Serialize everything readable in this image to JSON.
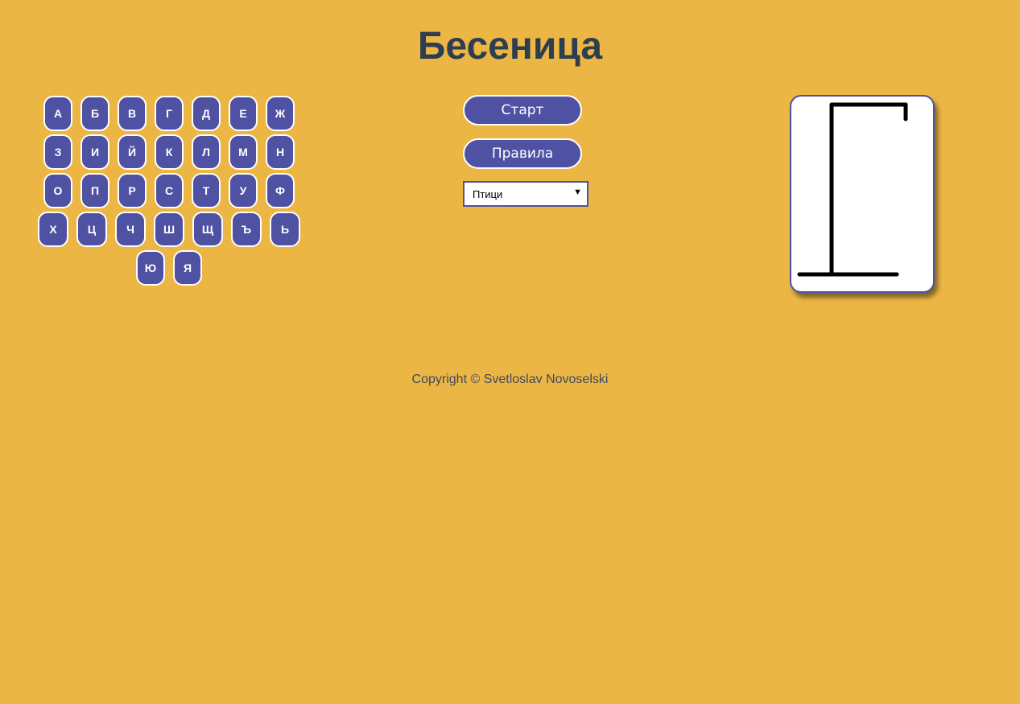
{
  "header": {
    "title": "Бесеница"
  },
  "keyboard": {
    "rows": [
      [
        "А",
        "Б",
        "В",
        "Г",
        "Д",
        "Е",
        "Ж"
      ],
      [
        "З",
        "И",
        "Й",
        "К",
        "Л",
        "М",
        "Н"
      ],
      [
        "О",
        "П",
        "Р",
        "С",
        "Т",
        "У",
        "Ф"
      ],
      [
        "Х",
        "Ц",
        "Ч",
        "Ш",
        "Щ",
        "Ъ",
        "Ь"
      ],
      [
        "Ю",
        "Я"
      ]
    ]
  },
  "controls": {
    "start_label": "Старт",
    "rules_label": "Правила",
    "category": {
      "selected": "Птици"
    }
  },
  "gallows": {
    "stage": 1,
    "stroke_color": "#000000"
  },
  "footer": {
    "copyright": "Copyright © Svetloslav Novoselski"
  },
  "colors": {
    "background": "#ecb644",
    "button": "#4f52a3",
    "title": "#2c3e50"
  }
}
